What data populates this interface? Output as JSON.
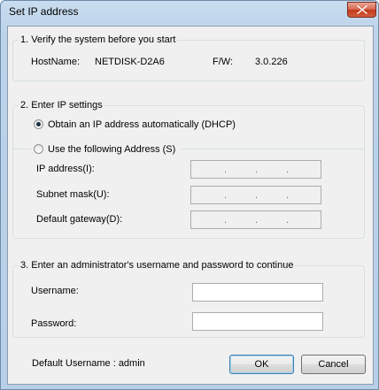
{
  "window": {
    "title": "Set IP address"
  },
  "verify": {
    "legend": "1. Verify the system before you start",
    "hostname_label": "HostName:",
    "hostname_value": "NETDISK-D2A6",
    "fw_label": "F/W:",
    "fw_value": "3.0.226"
  },
  "ip": {
    "legend": "2. Enter IP settings",
    "dhcp_label": "Obtain an IP address automatically (DHCP)",
    "manual_label": "Use the following Address (S)",
    "selected": "dhcp",
    "ip_address_label": "IP address(I):",
    "subnet_label": "Subnet mask(U):",
    "gateway_label": "Default gateway(D):",
    "separator": "."
  },
  "auth": {
    "legend": "3. Enter an administrator's username and password to continue",
    "username_label": "Username:",
    "username_value": "",
    "password_label": "Password:",
    "password_value": ""
  },
  "footer": {
    "default_user_text": "Default Username : admin",
    "ok_label": "OK",
    "cancel_label": "Cancel"
  }
}
